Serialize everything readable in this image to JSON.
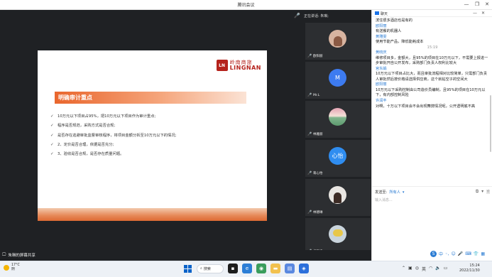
{
  "window": {
    "title": "腾讯会议"
  },
  "meeting": {
    "speaking_label": "正在讲话: 朱琳;",
    "sharing_label": "朱琳的屏幕共享"
  },
  "slide": {
    "logo_cn": "岭南商旅",
    "logo_en": "LINGNAN",
    "logo_mark": "LN",
    "heading": "明确审计重点",
    "items": [
      "10万元以下项目占95%，把10万元以下项目作为审计重点;",
      "程序是否规范，采购方式是否合规;",
      "是否存在逃避审批监督审核程序，将项目金额分拆至10万元以下的情况;",
      "2、定价是否合理，依据是否充分;",
      "3、验收是否合规，是否存在质量问题。"
    ],
    "bullet_glyph": "✓"
  },
  "participants": [
    {
      "name": "欧阳丽",
      "avatar_text": "",
      "avatar_color": "#d8b4a0"
    },
    {
      "name": "Mr.L",
      "avatar_text": "M",
      "avatar_color": "#3d7bf0"
    },
    {
      "name": "林雅丽",
      "avatar_text": "",
      "avatar_color": "#9ac6a8"
    },
    {
      "name": "蒋心怡",
      "avatar_text": "心怡",
      "avatar_color": "#2f8df0"
    },
    {
      "name": "林德琳",
      "avatar_text": "",
      "avatar_color": "#6b5a52"
    },
    {
      "name": "胡至峰",
      "avatar_text": "",
      "avatar_color": "#a7b9c9"
    }
  ],
  "chat": {
    "title": "聊天",
    "messages": [
      {
        "type": "text",
        "text": "滨住很多酒店也是有的"
      },
      {
        "type": "name",
        "text": "欧阳丽"
      },
      {
        "type": "text",
        "text": "有送餐的机器人"
      },
      {
        "type": "name",
        "text": "黄雅雯"
      },
      {
        "type": "text",
        "text": "使用节能产品，降低能耗成本"
      },
      {
        "type": "time",
        "text": "15:19"
      },
      {
        "type": "name",
        "text": "黄晓庆"
      },
      {
        "type": "text",
        "text": "维修项目多，金额大，且95%的项目在10万元以下，不需要上报进一步审批开自公开发布，采购部门负责人权利比较大"
      },
      {
        "type": "name",
        "text": "宫东娟"
      },
      {
        "type": "text",
        "text": "10万元以下项目占比大，而且审批流程相对比较简单，只需部门负责人审批然后按价格请选择供应商，这个就钻空子的空间大"
      },
      {
        "type": "name",
        "text": "欧阳丽"
      },
      {
        "type": "text",
        "text": "10万元以下采购控制由公司造价员编制，且95%的项目在10万元以下，有内部控制风险"
      },
      {
        "type": "name",
        "text": "许润丰"
      },
      {
        "type": "text",
        "text": "对啊，十万以下项目会不会出现舞弊情况呢，公开透明底不高"
      }
    ],
    "send_to_label": "发送至:",
    "send_to_value": "所有人",
    "input_placeholder": "输入消息..."
  },
  "ime": {
    "label": "中"
  },
  "taskbar": {
    "temperature": "17°C",
    "weather": "阴",
    "search_label": "搜索",
    "time": "15:24",
    "date": "2022/11/30",
    "tray_lang": "英"
  }
}
